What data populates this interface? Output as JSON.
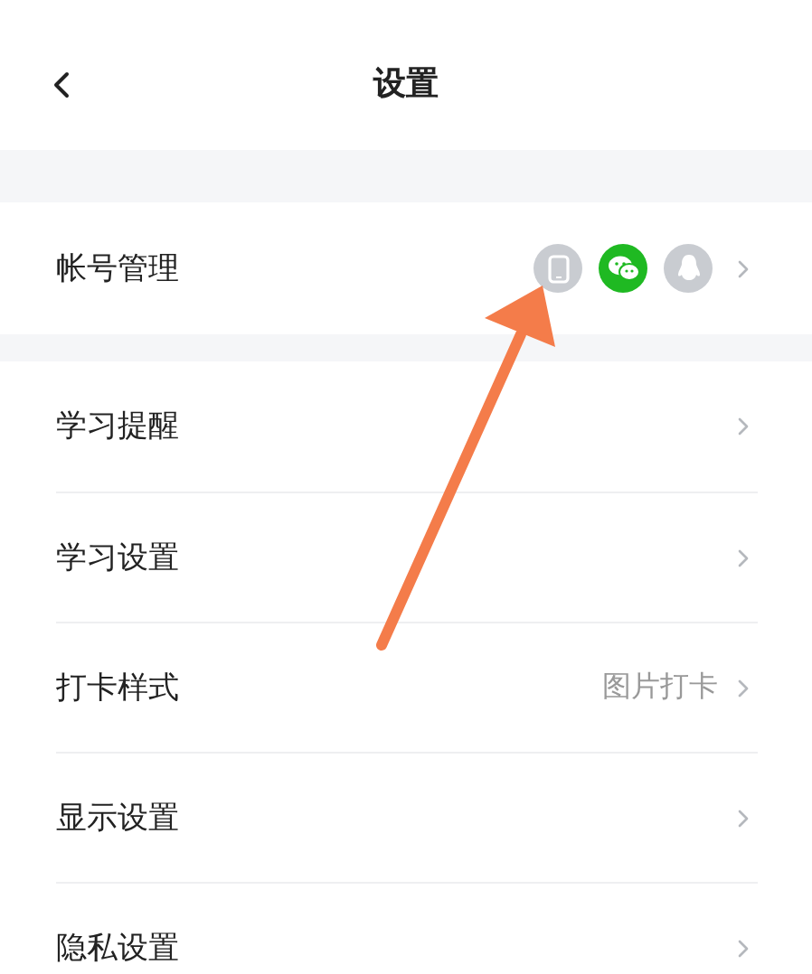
{
  "header": {
    "title": "设置"
  },
  "account": {
    "label": "帐号管理",
    "bindings": [
      {
        "kind": "phone",
        "linked": false
      },
      {
        "kind": "wechat",
        "linked": true
      },
      {
        "kind": "qq",
        "linked": false
      }
    ]
  },
  "rows": [
    {
      "label": "学习提醒"
    },
    {
      "label": "学习设置"
    },
    {
      "label": "打卡样式",
      "value": "图片打卡"
    },
    {
      "label": "显示设置"
    },
    {
      "label": "隐私设置"
    }
  ],
  "annotation": {
    "kind": "arrow"
  }
}
